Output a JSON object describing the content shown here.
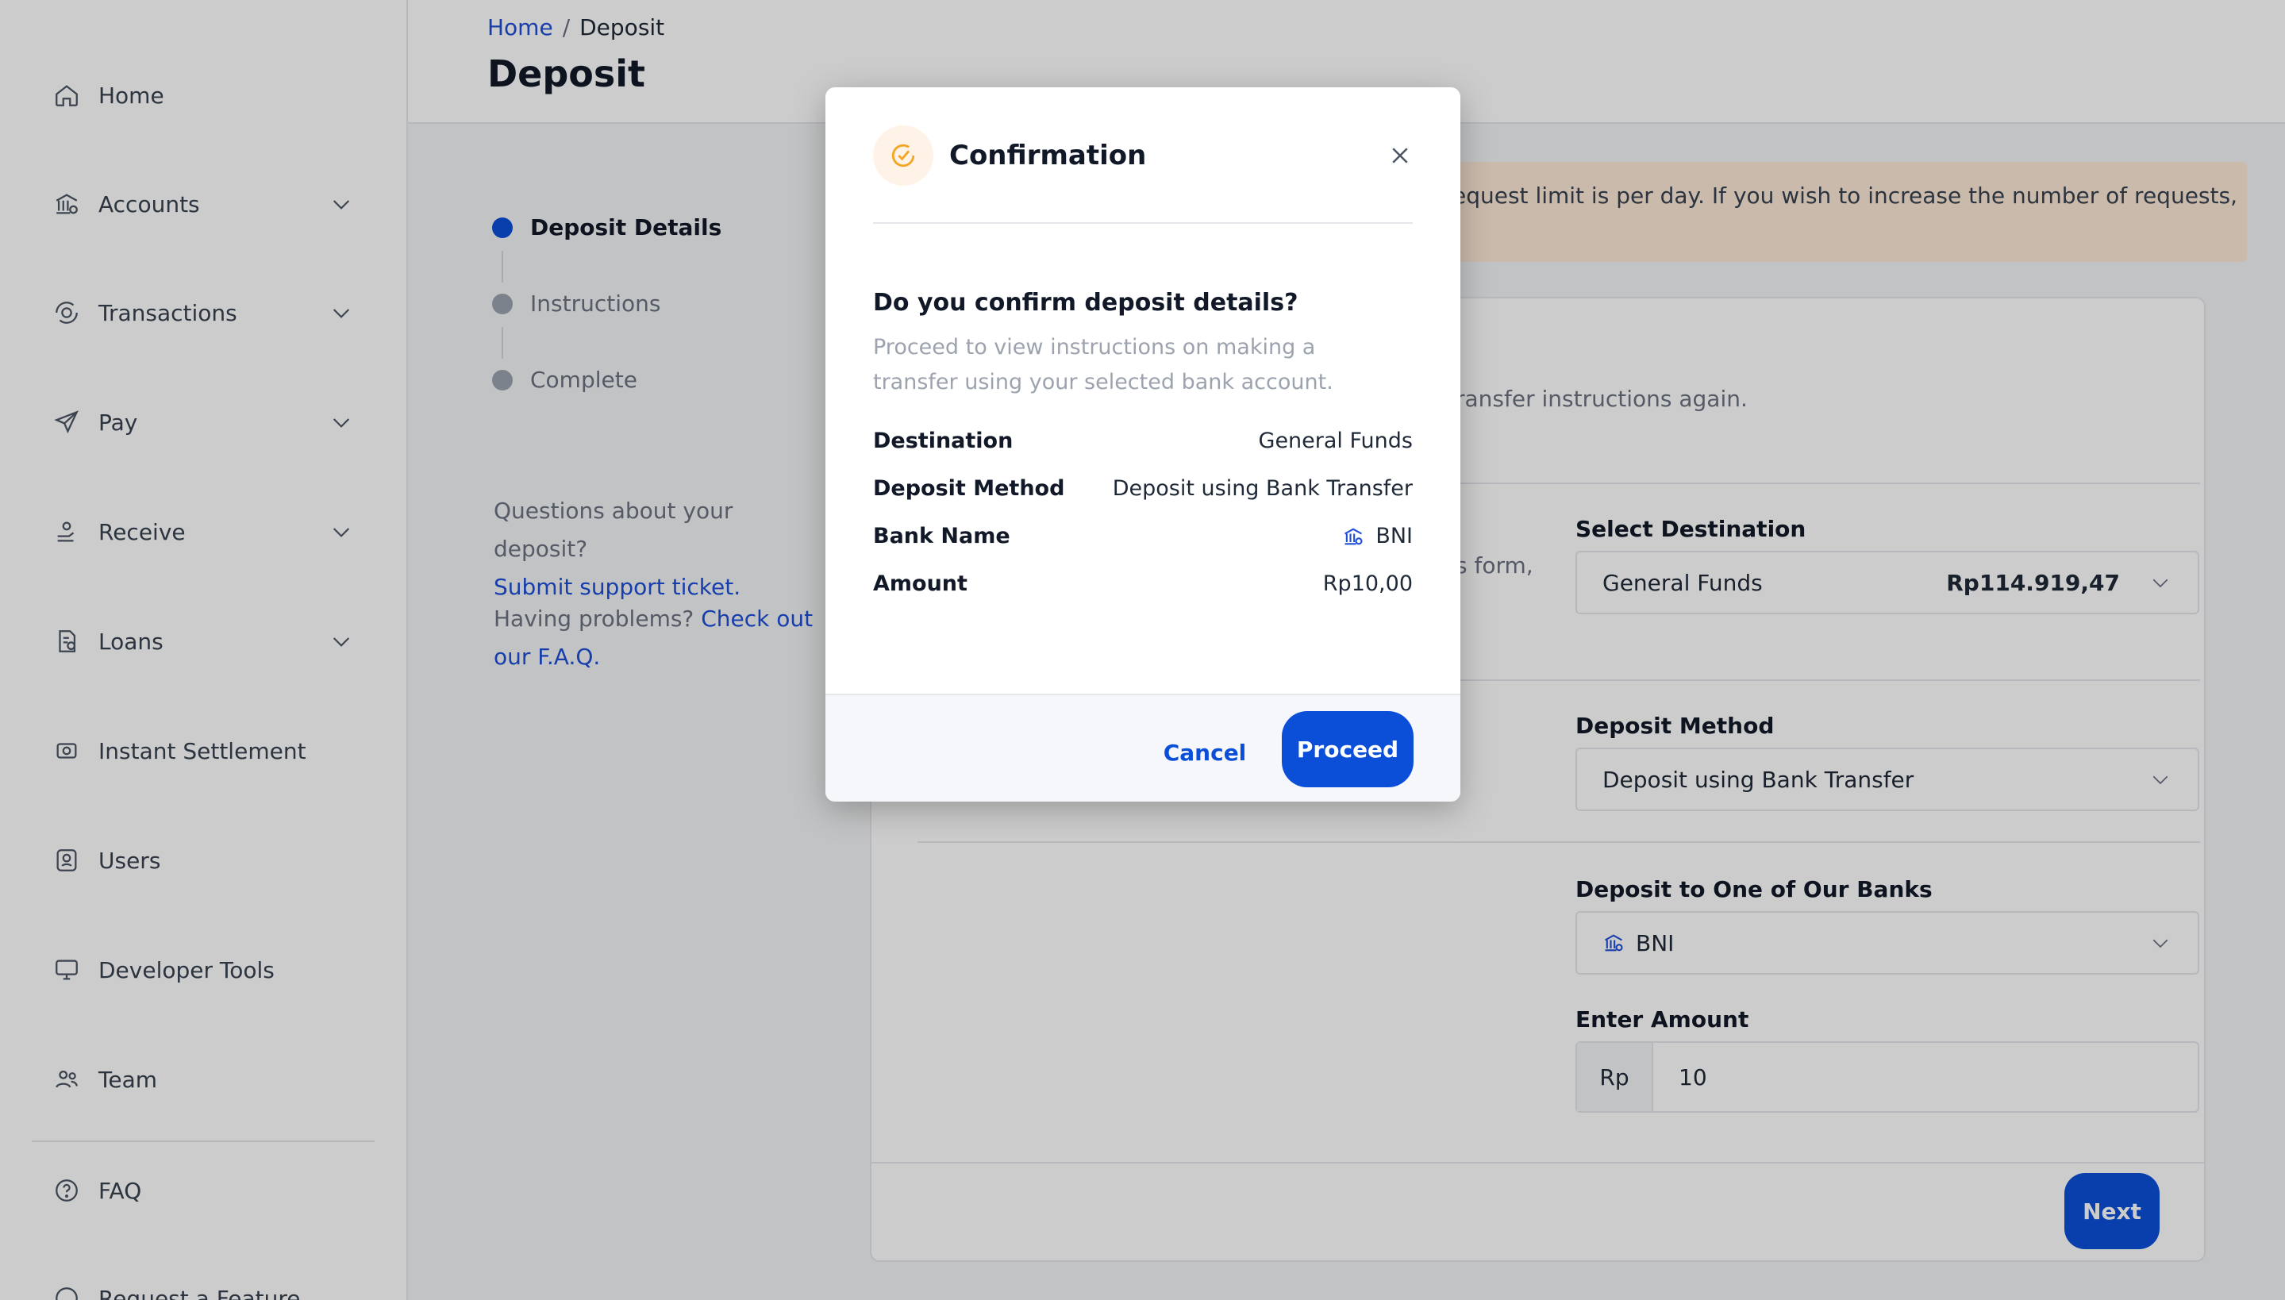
{
  "sidebar": {
    "items": [
      {
        "label": "Home",
        "icon": "home-icon",
        "expandable": false
      },
      {
        "label": "Accounts",
        "icon": "bank-icon",
        "expandable": true
      },
      {
        "label": "Transactions",
        "icon": "transactions-icon",
        "expandable": true
      },
      {
        "label": "Pay",
        "icon": "send-icon",
        "expandable": true
      },
      {
        "label": "Receive",
        "icon": "receive-icon",
        "expandable": true
      },
      {
        "label": "Loans",
        "icon": "loans-icon",
        "expandable": true
      },
      {
        "label": "Instant Settlement",
        "icon": "settlement-icon",
        "expandable": false
      },
      {
        "label": "Users",
        "icon": "users-icon",
        "expandable": false
      },
      {
        "label": "Developer Tools",
        "icon": "monitor-icon",
        "expandable": false
      },
      {
        "label": "Team",
        "icon": "team-icon",
        "expandable": false
      },
      {
        "label": "FAQ",
        "icon": "help-icon",
        "expandable": false
      },
      {
        "label": "Request a Feature",
        "icon": "feature-icon",
        "expandable": false
      }
    ]
  },
  "header": {
    "breadcrumb_home": "Home",
    "breadcrumb_sep": "/",
    "breadcrumb_current": "Deposit",
    "title": "Deposit"
  },
  "stepper": {
    "steps": [
      "Deposit Details",
      "Instructions",
      "Complete"
    ],
    "active_index": 0
  },
  "help": {
    "question": "Questions about your deposit?",
    "support_link": "Submit support ticket.",
    "problems": "Having problems?",
    "faq_link": "Check out our F.A.Q."
  },
  "notice": {
    "text": "equest limit is per day. If you wish to increase the number of requests,"
  },
  "form": {
    "subtitle": "ransfer instructions again.",
    "partial_text": "s form,",
    "destination_label": "Select Destination",
    "destination_value": "General Funds",
    "destination_balance": "Rp114.919,47",
    "method_label": "Deposit Method",
    "method_value": "Deposit using Bank Transfer",
    "bank_label": "Deposit to One of Our Banks",
    "bank_value": "BNI",
    "amount_label": "Enter Amount",
    "amount_prefix": "Rp",
    "amount_value": "10",
    "next_label": "Next"
  },
  "modal": {
    "title": "Confirmation",
    "question": "Do you confirm deposit details?",
    "description": "Proceed to view instructions on making a transfer using your selected bank account.",
    "rows": [
      {
        "key": "Destination",
        "value": "General Funds"
      },
      {
        "key": "Deposit Method",
        "value": "Deposit using Bank Transfer"
      },
      {
        "key": "Bank Name",
        "value": "BNI"
      },
      {
        "key": "Amount",
        "value": "Rp10,00"
      }
    ],
    "cancel_label": "Cancel",
    "proceed_label": "Proceed"
  },
  "colors": {
    "primary": "#0b4fd8",
    "link": "#1d4ed8",
    "notice_bg": "#fde9d7",
    "check_icon": "#f5a524"
  }
}
